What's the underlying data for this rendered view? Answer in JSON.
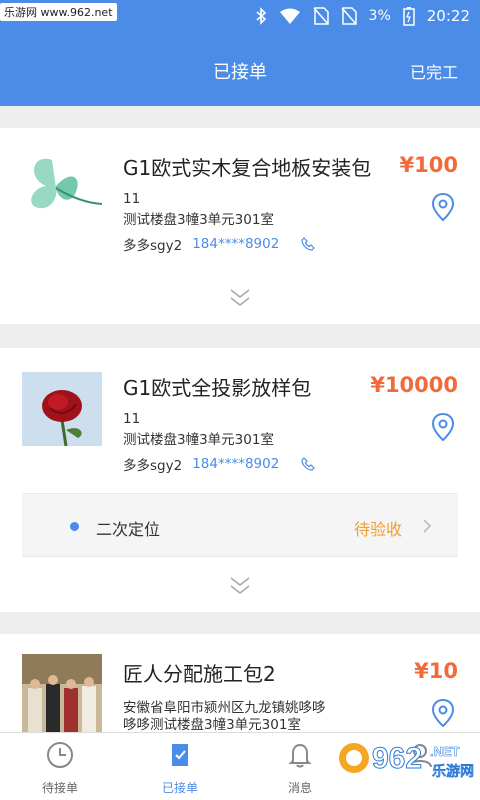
{
  "status_bar": {
    "watermark": "乐游网 www.962.net",
    "battery": "3%",
    "time": "20:22"
  },
  "header": {
    "title": "已接单",
    "right_action": "已完工"
  },
  "orders": [
    {
      "name": "G1欧式实木复合地板安装包",
      "price": "¥100",
      "line1": "11",
      "line2": "测试楼盘3幢3单元301室",
      "contact_name": "多多sgy2",
      "phone": "184****8902"
    },
    {
      "name": "G1欧式全投影放样包",
      "price": "¥10000",
      "line1": "11",
      "line2": "测试楼盘3幢3单元301室",
      "contact_name": "多多sgy2",
      "phone": "184****8902",
      "sub_task": {
        "label": "二次定位",
        "status": "待验收"
      }
    },
    {
      "name": "匠人分配施工包2",
      "price": "¥10",
      "line1": "安徽省阜阳市颍州区九龙镇姚哆哆",
      "line2": "哆哆测试楼盘3幢3单元301室"
    }
  ],
  "tabs": [
    {
      "label": "待接单",
      "icon": "clock-icon"
    },
    {
      "label": "已接单",
      "icon": "check-doc-icon",
      "active": true
    },
    {
      "label": "消息",
      "icon": "bell-icon"
    },
    {
      "label": "",
      "icon": "user-icon"
    }
  ],
  "watermark_962": {
    "big": "962",
    "suffix": ".NET",
    "cn": "乐游网"
  },
  "colors": {
    "primary": "#4a8ce8",
    "price": "#f36a3a",
    "pending": "#f0a030"
  }
}
